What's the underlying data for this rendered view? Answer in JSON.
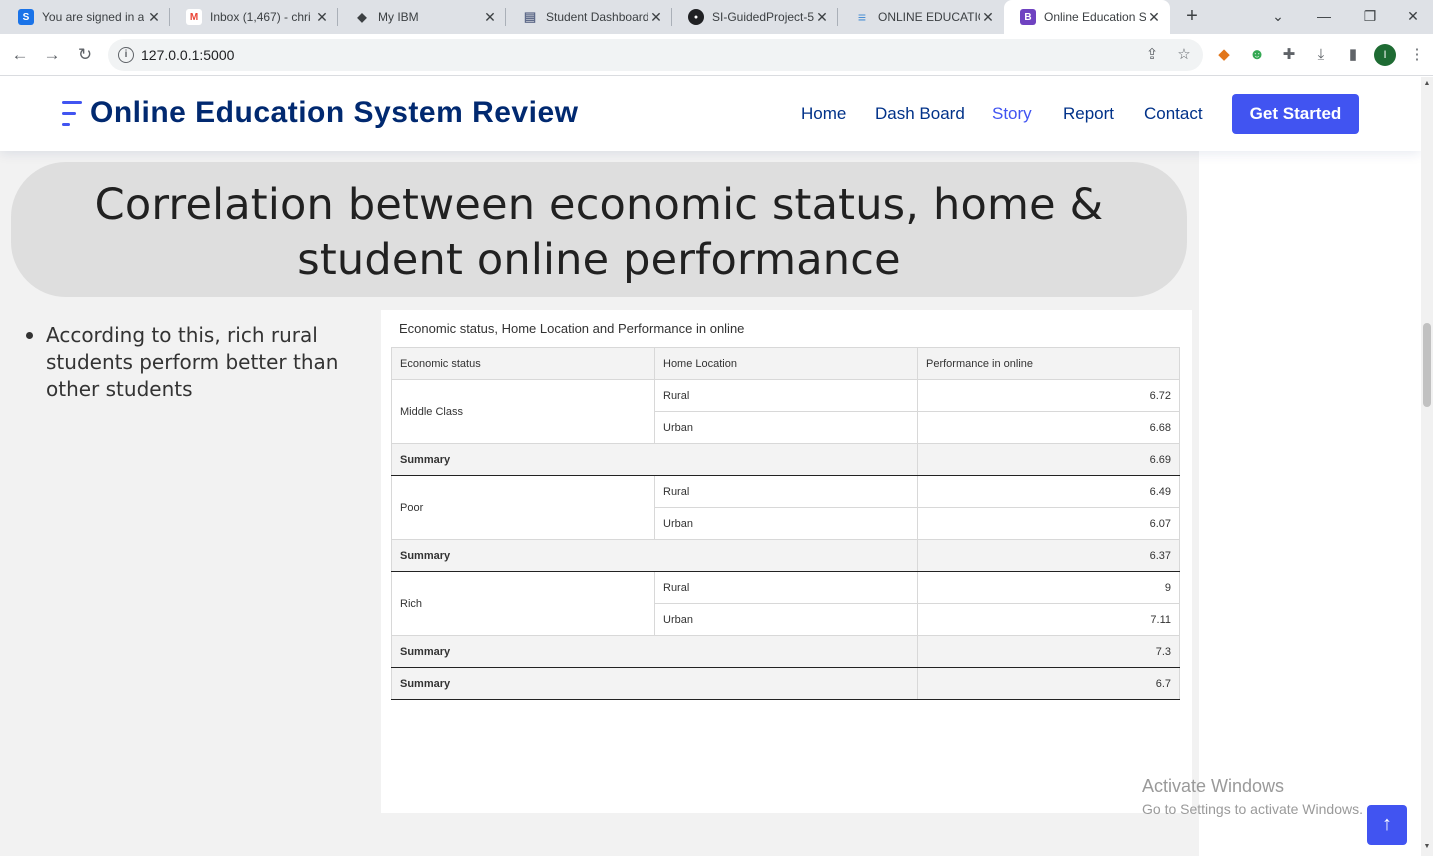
{
  "browser": {
    "tabs": [
      {
        "title": "You are signed in a",
        "favicon": "s-icon",
        "color": "#1a73e8",
        "letter": "S"
      },
      {
        "title": "Inbox (1,467) - chri",
        "favicon": "gmail-icon",
        "color": "#ea4335",
        "letter": "M"
      },
      {
        "title": "My IBM",
        "favicon": "ibm-icon",
        "color": "#3c4043",
        "letter": "◆"
      },
      {
        "title": "Student Dashboard",
        "favicon": "dashboard-icon",
        "color": "#5f6b8a",
        "letter": "▤"
      },
      {
        "title": "SI-GuidedProject-5",
        "favicon": "github-icon",
        "color": "#202124",
        "letter": "●"
      },
      {
        "title": "ONLINE EDUCATIO",
        "favicon": "list-icon",
        "color": "#4a8fd4",
        "letter": "≡"
      },
      {
        "title": "Online Education S",
        "favicon": "bootstrap-icon",
        "color": "#6f42c1",
        "letter": "B",
        "active": true
      }
    ],
    "url": "127.0.0.1:5000",
    "profile_initial": "I"
  },
  "site": {
    "title": "Online Education System Review",
    "nav": [
      "Home",
      "Dash Board",
      "Story",
      "Report",
      "Contact"
    ],
    "active_nav": "Story",
    "cta": "Get Started"
  },
  "section": {
    "heading": "Correlation between economic status, home & student online performance",
    "bullet": "According to this, rich rural students  perform better than other students"
  },
  "viz": {
    "title": "Economic status, Home Location and Performance in online",
    "columns": [
      "Economic status",
      "Home Location",
      "Performance in online"
    ],
    "groups": [
      {
        "status": "Middle Class",
        "rows": [
          {
            "location": "Rural",
            "value": "6.72"
          },
          {
            "location": "Urban",
            "value": "6.68"
          }
        ],
        "summary_label": "Summary",
        "summary": "6.69"
      },
      {
        "status": "Poor",
        "rows": [
          {
            "location": "Rural",
            "value": "6.49"
          },
          {
            "location": "Urban",
            "value": "6.07"
          }
        ],
        "summary_label": "Summary",
        "summary": "6.37"
      },
      {
        "status": "Rich",
        "rows": [
          {
            "location": "Rural",
            "value": "9"
          },
          {
            "location": "Urban",
            "value": "7.11"
          }
        ],
        "summary_label": "Summary",
        "summary": "7.3"
      }
    ],
    "grand_total_label": "Summary",
    "grand_total": "6.7"
  },
  "watermark": {
    "line1": "Activate Windows",
    "line2": "Go to Settings to activate Windows."
  },
  "colors": {
    "accent": "#4154f1",
    "brand_dark": "#012970"
  }
}
